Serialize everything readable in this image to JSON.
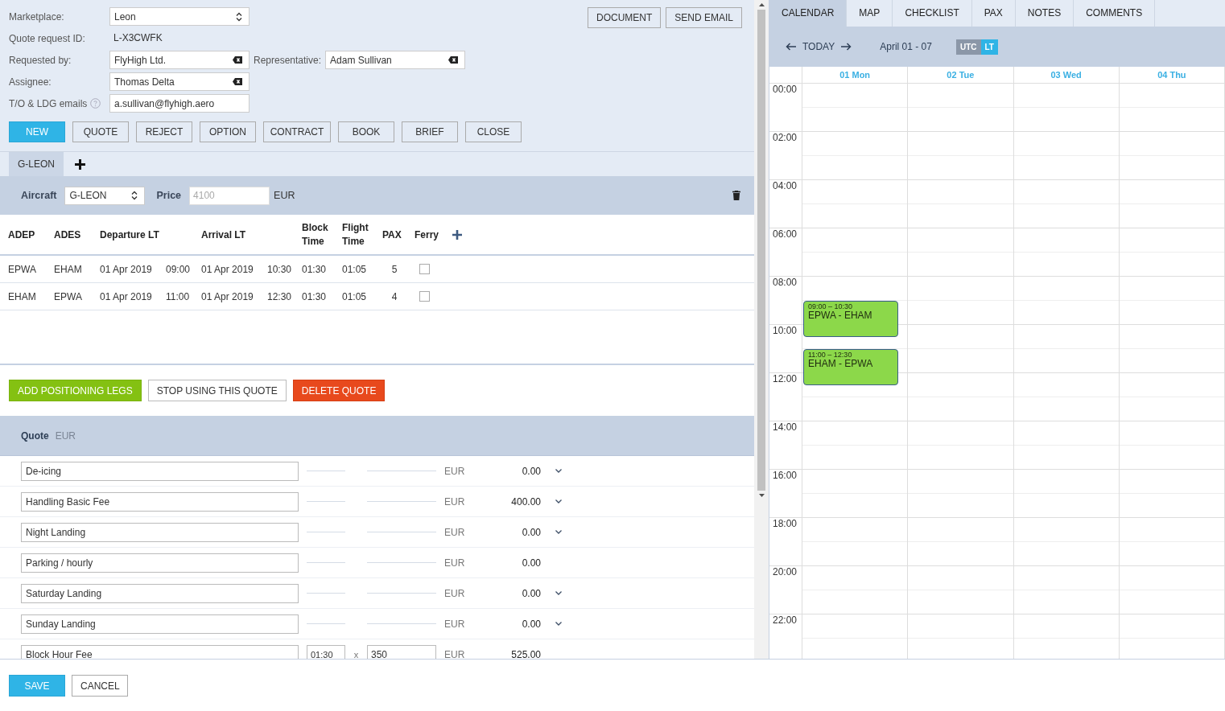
{
  "form": {
    "marketplace": {
      "label": "Marketplace:",
      "value": "Leon"
    },
    "quote_request_id": {
      "label": "Quote request ID:",
      "value": "L-X3CWFK"
    },
    "requested_by": {
      "label": "Requested by:",
      "value": "FlyHigh Ltd."
    },
    "representative": {
      "label": "Representative:",
      "value": "Adam Sullivan"
    },
    "assignee": {
      "label": "Assignee:",
      "value": "Thomas Delta"
    },
    "emails": {
      "label": "T/O & LDG emails",
      "value": "a.sullivan@flyhigh.aero"
    }
  },
  "header_buttons": [
    "DOCUMENT",
    "SEND EMAIL"
  ],
  "status_buttons": [
    {
      "label": "NEW",
      "selected": true
    },
    {
      "label": "QUOTE",
      "selected": false
    },
    {
      "label": "REJECT",
      "selected": false
    },
    {
      "label": "OPTION",
      "selected": false
    },
    {
      "label": "CONTRACT",
      "selected": false
    },
    {
      "label": "BOOK",
      "selected": false
    },
    {
      "label": "BRIEF",
      "selected": false
    },
    {
      "label": "CLOSE",
      "selected": false
    }
  ],
  "aircraft_tabs": [
    {
      "label": "G-LEON",
      "selected": true
    }
  ],
  "aircraft": {
    "label": "Aircraft",
    "value": "G-LEON",
    "price_label": "Price",
    "price_placeholder": "4100",
    "currency": "EUR"
  },
  "legs": {
    "columns": [
      "ADEP",
      "ADES",
      "Departure LT",
      "Arrival LT",
      "Block Time",
      "Flight Time",
      "PAX",
      "Ferry"
    ],
    "rows": [
      {
        "adep": "EPWA",
        "ades": "EHAM",
        "dep_date": "01 Apr 2019",
        "dep_time": "09:00",
        "arr_date": "01 Apr 2019",
        "arr_time": "10:30",
        "block": "01:30",
        "flight": "01:05",
        "pax": "5",
        "ferry": false
      },
      {
        "adep": "EHAM",
        "ades": "EPWA",
        "dep_date": "01 Apr 2019",
        "dep_time": "11:00",
        "arr_date": "01 Apr 2019",
        "arr_time": "12:30",
        "block": "01:30",
        "flight": "01:05",
        "pax": "4",
        "ferry": false
      }
    ]
  },
  "leg_actions": [
    {
      "label": "ADD POSITIONING LEGS",
      "kind": "positive"
    },
    {
      "label": "STOP USING THIS QUOTE",
      "kind": "plain"
    },
    {
      "label": "DELETE QUOTE",
      "kind": "danger"
    }
  ],
  "quote": {
    "title": "Quote",
    "currency": "EUR",
    "items": [
      {
        "name": "De-icing",
        "currency": "EUR",
        "amount": "0.00",
        "menu": true
      },
      {
        "name": "Handling Basic Fee",
        "currency": "EUR",
        "amount": "400.00",
        "menu": true
      },
      {
        "name": "Night Landing",
        "currency": "EUR",
        "amount": "0.00",
        "menu": true
      },
      {
        "name": "Parking / hourly",
        "currency": "EUR",
        "amount": "0.00",
        "menu": false
      },
      {
        "name": "Saturday Landing",
        "currency": "EUR",
        "amount": "0.00",
        "menu": true
      },
      {
        "name": "Sunday Landing",
        "currency": "EUR",
        "amount": "0.00",
        "menu": true
      },
      {
        "name": "Block Hour Fee",
        "quantity": "01:30",
        "times": "x",
        "rate": "350",
        "currency": "EUR",
        "amount": "525.00",
        "menu": false
      }
    ]
  },
  "footer_buttons": [
    {
      "label": "SAVE",
      "kind": "primary"
    },
    {
      "label": "CANCEL",
      "kind": "plain"
    }
  ],
  "side_tabs": [
    {
      "label": "CALENDAR",
      "selected": true
    },
    {
      "label": "MAP",
      "selected": false
    },
    {
      "label": "CHECKLIST",
      "selected": false
    },
    {
      "label": "PAX",
      "selected": false
    },
    {
      "label": "NOTES",
      "selected": false
    },
    {
      "label": "COMMENTS",
      "selected": false
    }
  ],
  "calendar": {
    "today": "TODAY",
    "range": "April 01 - 07",
    "zones": [
      {
        "label": "UTC",
        "selected": false
      },
      {
        "label": "LT",
        "selected": true
      }
    ],
    "days": [
      {
        "label": "01 Mon",
        "events": [
          {
            "time": "09:00 – 10:30",
            "route": "EPWA - EHAM"
          },
          {
            "time": "11:00 – 12:30",
            "route": "EHAM - EPWA"
          }
        ]
      },
      {
        "label": "02 Tue"
      },
      {
        "label": "03 Wed"
      },
      {
        "label": "04 Thu"
      }
    ],
    "times": [
      "00:00",
      "02:00",
      "04:00",
      "06:00",
      "08:00",
      "10:00",
      "12:00",
      "14:00",
      "16:00",
      "18:00",
      "20:00",
      "22:00"
    ]
  }
}
